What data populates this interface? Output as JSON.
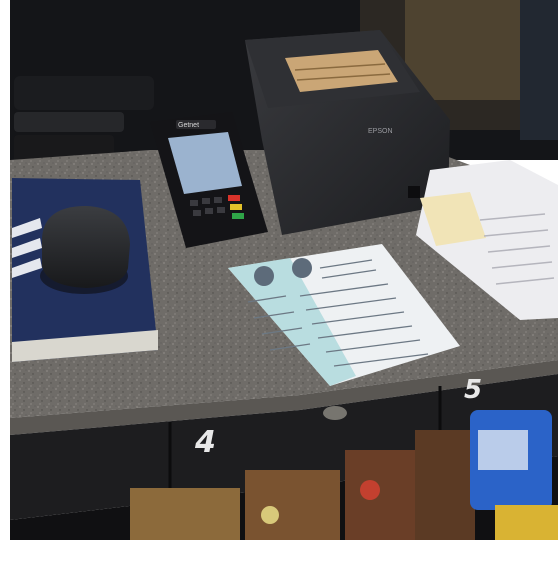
{
  "terminal": {
    "brand": "Getnet"
  },
  "printer": {
    "brand": "EPSON"
  },
  "counter_labels": {
    "drawer_left": "4",
    "drawer_right": "5"
  },
  "colors": {
    "counter_granite": "#6f6c68",
    "counter_edge": "#5a5753",
    "drawer_front": "#1d1d1f",
    "notebook_blue": "#22315e",
    "receipt_teal": "#b9dde0",
    "printer_body": "#2a2b2e",
    "background_dark": "#141518",
    "shelf_blue_bottle": "#2b63c8"
  }
}
